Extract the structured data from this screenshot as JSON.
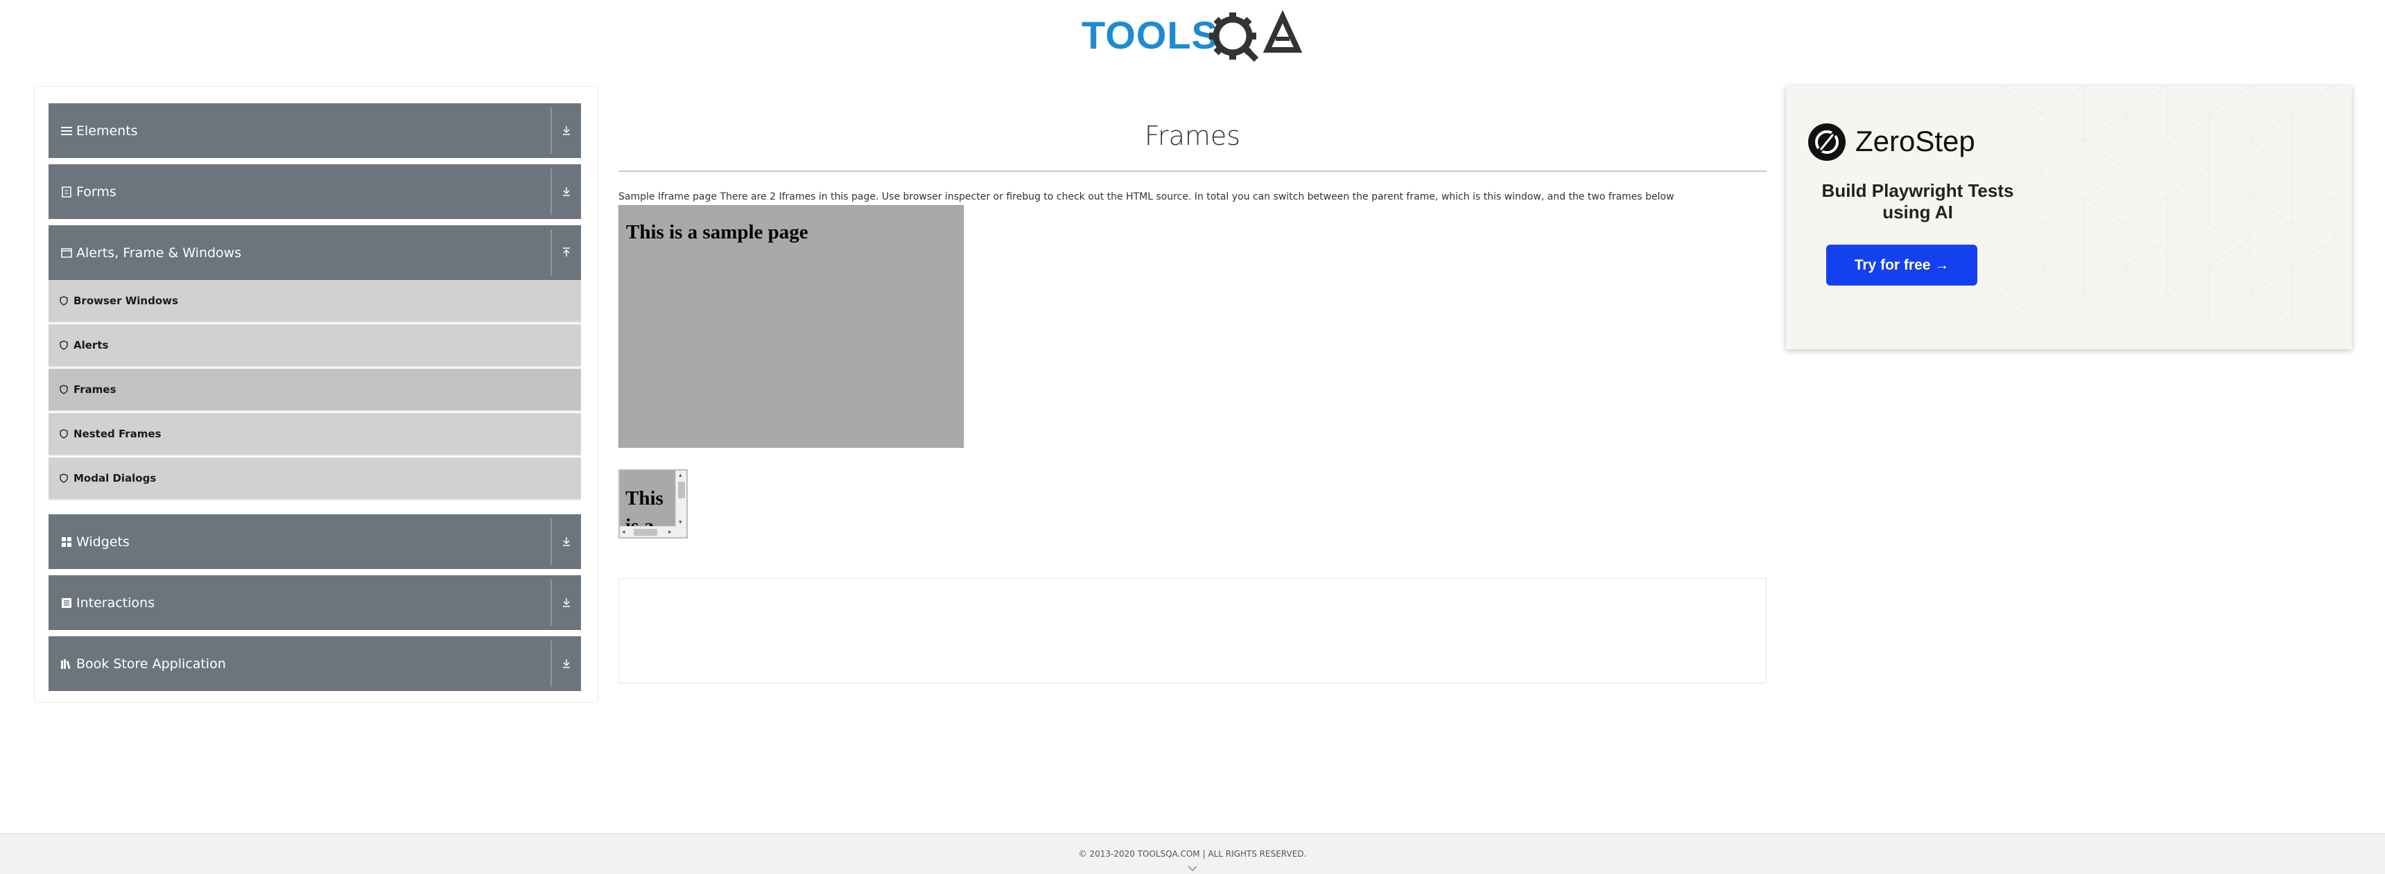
{
  "header": {
    "logo_text": "TOOLSQA",
    "logo_colors": {
      "tools": "#1d8bd1",
      "qa": "#333333"
    }
  },
  "sidebar": {
    "groups": [
      {
        "title": "Elements",
        "icon": "menu-icon",
        "expanded": false
      },
      {
        "title": "Forms",
        "icon": "document-icon",
        "expanded": false
      },
      {
        "title": "Alerts, Frame & Windows",
        "icon": "window-icon",
        "expanded": true,
        "items": [
          {
            "label": "Browser Windows",
            "active": false
          },
          {
            "label": "Alerts",
            "active": false
          },
          {
            "label": "Frames",
            "active": true
          },
          {
            "label": "Nested Frames",
            "active": false
          },
          {
            "label": "Modal Dialogs",
            "active": false
          }
        ]
      },
      {
        "title": "Widgets",
        "icon": "grid-icon",
        "expanded": false
      },
      {
        "title": "Interactions",
        "icon": "list-icon",
        "expanded": false
      },
      {
        "title": "Book Store Application",
        "icon": "books-icon",
        "expanded": false
      }
    ],
    "colors": {
      "header_bg": "#6c757d",
      "item_bg": "#d1d1d1",
      "active_item_bg": "#c3c3c3"
    }
  },
  "main": {
    "title": "Frames",
    "description": "Sample Iframe page There are 2 Iframes in this page. Use browser inspecter or firebug to check out the HTML source. In total you can switch between the parent frame, which is this window, and the two frames below",
    "frame1_text": "This is a sample page",
    "frame2_text": "This is a sample page",
    "frame_bg": "#a9a9a9"
  },
  "ad": {
    "brand": "ZeroStep",
    "tagline": "Build Playwright Tests using AI",
    "cta": "Try for free →",
    "cta_color": "#1540f0"
  },
  "footer": {
    "text": "© 2013-2020 TOOLSQA.COM | ALL RIGHTS RESERVED."
  }
}
